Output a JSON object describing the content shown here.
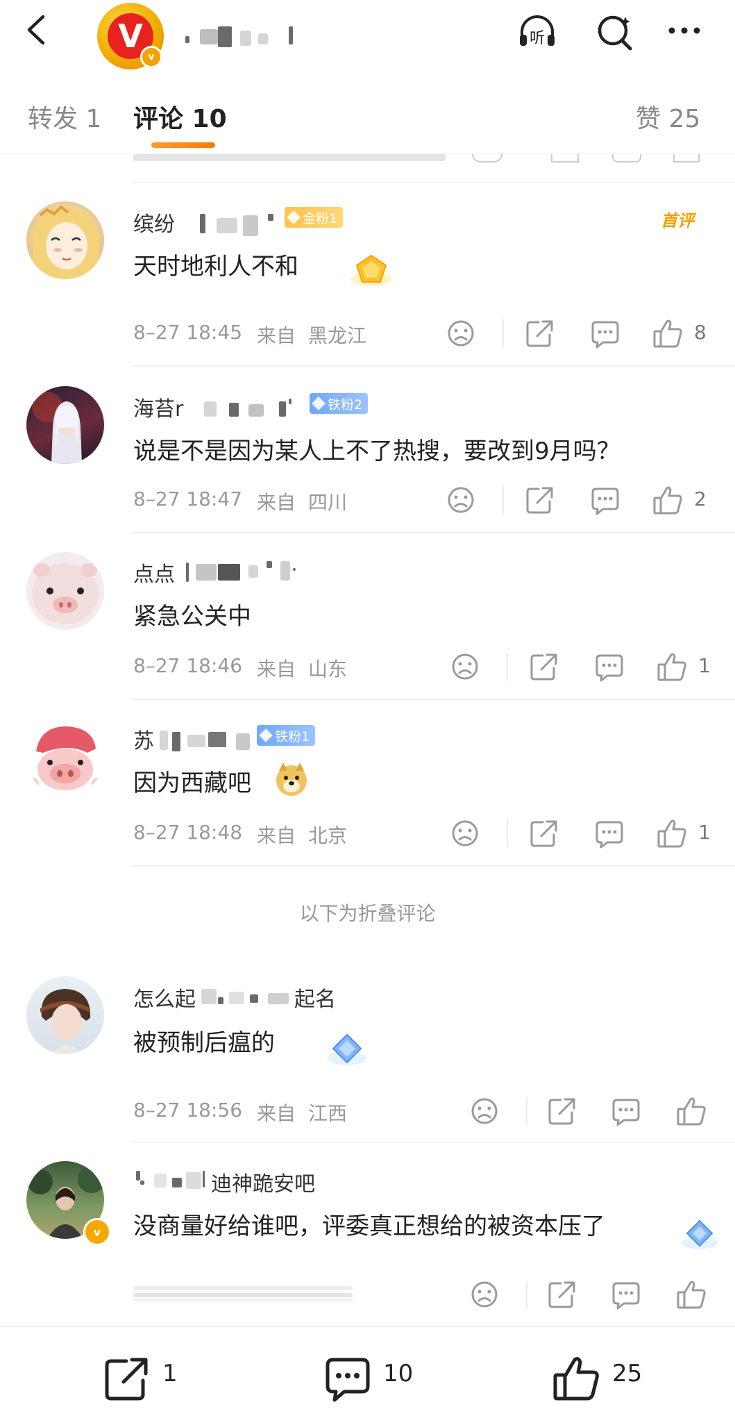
{
  "header": {
    "listen_label": "听",
    "logo_letter": "V",
    "logo_badge": "v"
  },
  "tabs": [
    {
      "label": "转发 1"
    },
    {
      "label": "评论 10"
    },
    {
      "label": "赞 25"
    }
  ],
  "comments": [
    {
      "name": "缤纷",
      "badge": "金粉1",
      "tag": "首评",
      "text": "天时地利人不和",
      "time": "8–27 18:45",
      "from": "来自",
      "location": "黑龙江",
      "likes": "8"
    },
    {
      "name": "海苔r",
      "badge": "铁粉2",
      "text": "说是不是因为某人上不了热搜，要改到9月吗？",
      "time": "8–27 18:47",
      "from": "来自",
      "location": "四川",
      "likes": "2"
    },
    {
      "name": "点点",
      "text": "紧急公关中",
      "time": "8–27 18:46",
      "from": "来自",
      "location": "山东",
      "likes": "1"
    },
    {
      "name": "苏",
      "badge": "铁粉1",
      "text": "因为西藏吧",
      "time": "8–27 18:48",
      "from": "来自",
      "location": "北京",
      "likes": "1"
    }
  ],
  "fold_label": "以下为折叠评论",
  "folded": [
    {
      "name_start": "怎么起",
      "name_end": "起名",
      "text": "被预制后瘟的",
      "time": "8–27 18:56",
      "from": "来自",
      "location": "江西"
    },
    {
      "name_end": "迪神跪安吧",
      "text": "没商量好给谁吧，评委真正想给的被资本压了"
    }
  ],
  "bottom": {
    "repost_count": "1",
    "comment_count": "10",
    "like_count": "25"
  },
  "colors": {
    "accent": "#ff8200",
    "gold_badge": "#ffc24a",
    "iron_badge": "#6fa8ff",
    "meta_gray": "#999999"
  }
}
